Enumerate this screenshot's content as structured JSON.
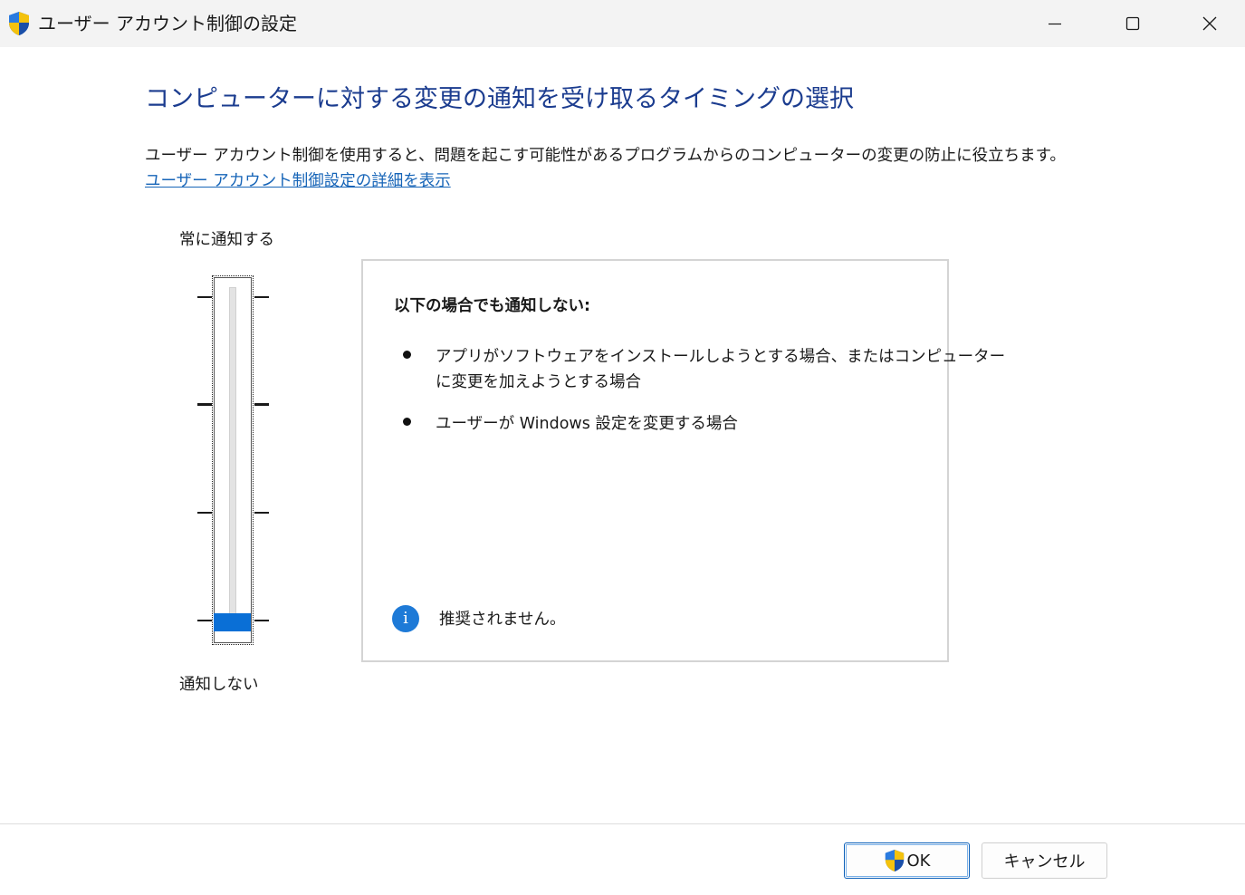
{
  "window": {
    "title": "ユーザー アカウント制御の設定",
    "title_icon": "uac-shield-icon"
  },
  "caption_buttons": {
    "minimize_icon": "minimize-icon",
    "maximize_icon": "maximize-icon",
    "close_icon": "close-icon"
  },
  "main": {
    "heading": "コンピューターに対する変更の通知を受け取るタイミングの選択",
    "description": "ユーザー アカウント制御を使用すると、問題を起こす可能性があるプログラムからのコンピューターの変更の防止に役立ちます。",
    "details_link": "ユーザー アカウント制御設定の詳細を表示"
  },
  "slider": {
    "top_label": "常に通知する",
    "bottom_label": "通知しない",
    "levels": 4,
    "selected_level": 1,
    "thumb_color": "#0a6fd6"
  },
  "panel": {
    "heading": "以下の場合でも通知しない:",
    "items": [
      "アプリがソフトウェアをインストールしようとする場合、またはコンピューター",
      "に変更を加えようとする場合",
      "ユーザーが Windows 設定を変更する場合"
    ],
    "note_icon": "info-icon",
    "note": "推奨されません。"
  },
  "footer": {
    "ok_label": "OK",
    "ok_icon": "uac-shield-icon",
    "cancel_label": "キャンセル"
  },
  "colors": {
    "heading": "#1b3c8f",
    "link": "#1765b8",
    "accent": "#0a6fd6",
    "info": "#1e7ad7"
  }
}
